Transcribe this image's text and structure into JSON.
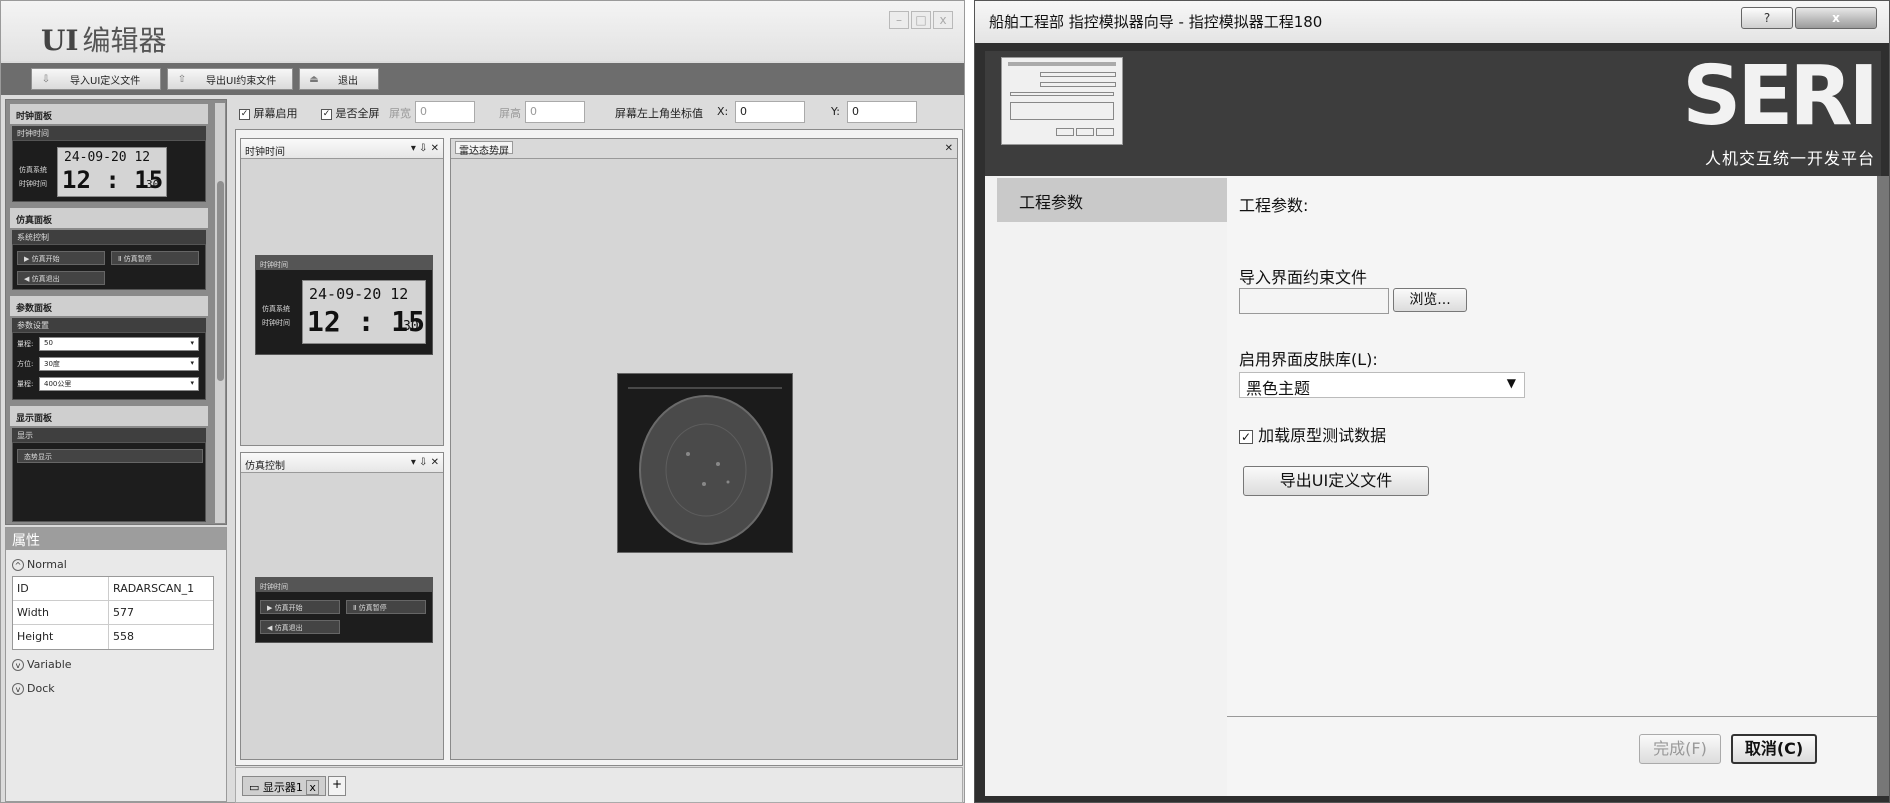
{
  "editor": {
    "title_bold": "UI",
    "title_rest": "编辑器",
    "window_buttons": [
      "–",
      "□",
      "x"
    ],
    "toolbar": {
      "import_label": "导入UI定义文件",
      "export_label": "导出UI约束文件",
      "exit_label": "退出"
    },
    "palette": {
      "clock_panel": {
        "title": "时钟面板",
        "sub": "时钟时间",
        "label1": "仿真系统",
        "label2": "时钟时间",
        "date": "24-09-20 12",
        "time": "12 : 15",
        "seconds": "30"
      },
      "sim_panel": {
        "title": "仿真面板",
        "sub": "系统控制",
        "btn_start": "仿真开始",
        "btn_pause": "仿真暂停",
        "btn_exit": "仿真退出"
      },
      "param_panel": {
        "title": "参数面板",
        "sub": "参数设置",
        "row1_label": "量程:",
        "row1_value": "50",
        "row2_label": "方位:",
        "row2_value": "30度",
        "row3_label": "量程:",
        "row3_value": "400公里"
      },
      "display_panel": {
        "title": "显示面板",
        "sub": "显示",
        "item": "态势显示"
      }
    },
    "properties": {
      "header": "属性",
      "section_normal": "Normal",
      "rows": [
        {
          "key": "ID",
          "value": "RADARSCAN_1"
        },
        {
          "key": "Width",
          "value": "577"
        },
        {
          "key": "Height",
          "value": "558"
        }
      ],
      "section_variable": "Variable",
      "section_dock": "Dock"
    },
    "screenbar": {
      "screen_enable": "屏幕启用",
      "fullscreen": "是否全屏",
      "width_label": "屏宽",
      "width_value": "0",
      "height_label": "屏高",
      "height_value": "0",
      "origin_label": "屏幕左上角坐标值",
      "x_label": "X:",
      "x_value": "0",
      "y_label": "Y:",
      "y_value": "0"
    },
    "docks": {
      "clock_title": "时钟时间",
      "sim_title": "仿真控制",
      "radar_title": "雷达态势屏",
      "dock_controls": "▾ ⇩ ✕"
    },
    "statusbar": {
      "tab_label": "显示器1",
      "add_label": "+"
    }
  },
  "dialog": {
    "title": "船舶工程部 指控模拟器向导 - 指控模拟器工程180",
    "help_btn": "?",
    "close_btn": "x",
    "brand": "SERI",
    "brand_sub": "人机交互统一开发平台",
    "nav_item": "工程参数",
    "section_title": "工程参数:",
    "import_label": "导入界面约束文件",
    "import_value": "",
    "browse_btn": "浏览...",
    "skin_label": "启用界面皮肤库(L):",
    "skin_value": "黑色主题",
    "load_data_label": "加载原型测试数据",
    "export_btn": "导出UI定义文件",
    "finish_btn": "完成(F)",
    "cancel_btn": "取消(C)"
  }
}
